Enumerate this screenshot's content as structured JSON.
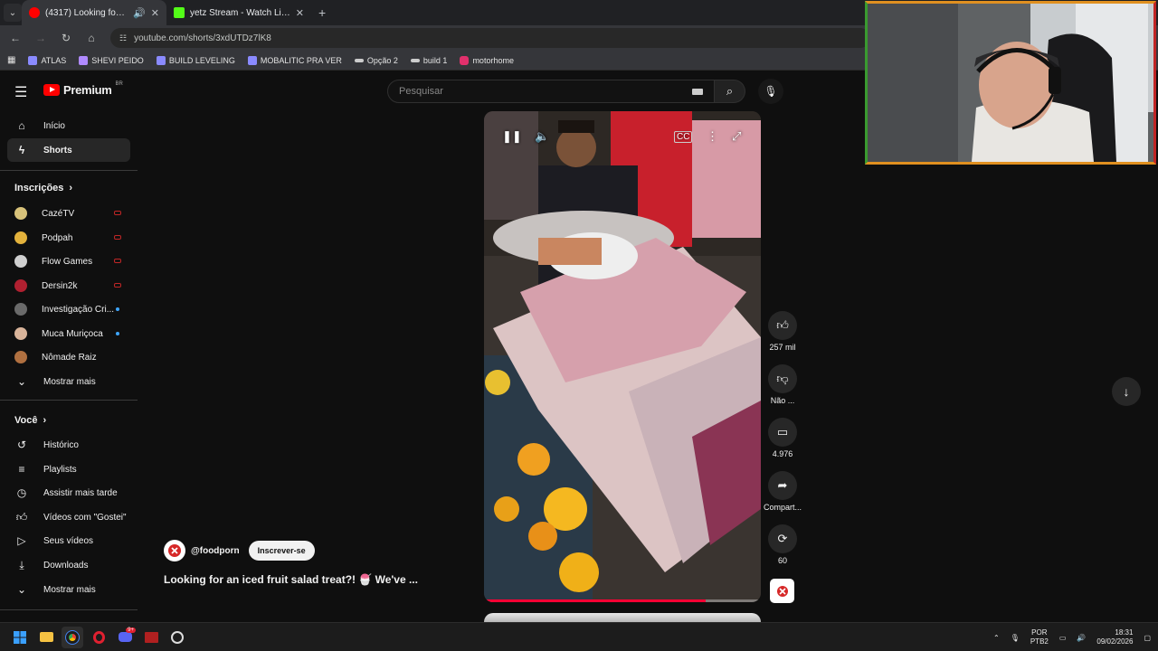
{
  "browser": {
    "tabs": [
      {
        "title": "(4317) Looking for an iced f",
        "active": true,
        "favicon_color": "#ff0000"
      },
      {
        "title": "yetz Stream - Watch Live on Kic",
        "active": false,
        "favicon_color": "#53fc18"
      }
    ],
    "url": "youtube.com/shorts/3xdUTDz7lK8",
    "bookmarks": [
      {
        "label": "ATLAS",
        "icon": "shield-icon",
        "color": "#8a8aff"
      },
      {
        "label": "SHEVI PEIDO",
        "icon": "bookmark-icon",
        "color": "#b08aff"
      },
      {
        "label": "BUILD LEVELING",
        "icon": "shield-icon",
        "color": "#8a8aff"
      },
      {
        "label": "MOBALITIC PRA VER",
        "icon": "shield-icon",
        "color": "#8a8aff"
      },
      {
        "label": "Opção 2",
        "icon": "link-icon",
        "color": "#cccccc"
      },
      {
        "label": "build 1",
        "icon": "link-icon",
        "color": "#cccccc"
      },
      {
        "label": "motorhome",
        "icon": "instagram-icon",
        "color": "#e1306c"
      }
    ]
  },
  "youtube": {
    "brand": "Premium",
    "country": "BR",
    "search_placeholder": "Pesquisar",
    "sidebar": {
      "main": [
        {
          "label": "Início",
          "icon": "home-icon",
          "active": false
        },
        {
          "label": "Shorts",
          "icon": "shorts-icon",
          "active": true
        }
      ],
      "subscriptions_header": "Inscrições",
      "subscriptions": [
        {
          "label": "CazéTV",
          "avatar_color": "#d8c27a",
          "status": "live"
        },
        {
          "label": "Podpah",
          "avatar_color": "#e3b23c",
          "status": "live"
        },
        {
          "label": "Flow Games",
          "avatar_color": "#cfcfcf",
          "status": "live"
        },
        {
          "label": "Dersin2k",
          "avatar_color": "#b02030",
          "status": "live"
        },
        {
          "label": "Investigação Cri...",
          "avatar_color": "#6a6a6a",
          "status": "new"
        },
        {
          "label": "Muca Muriçoca",
          "avatar_color": "#d9b49a",
          "status": "new"
        },
        {
          "label": "Nômade Raiz",
          "avatar_color": "#b07040",
          "status": "none"
        }
      ],
      "subscriptions_more": "Mostrar mais",
      "you_header": "Você",
      "you": [
        {
          "label": "Histórico",
          "icon": "history-icon"
        },
        {
          "label": "Playlists",
          "icon": "playlist-icon"
        },
        {
          "label": "Assistir mais tarde",
          "icon": "clock-icon"
        },
        {
          "label": "Vídeos com \"Gostei\"",
          "icon": "thumbs-up-icon"
        },
        {
          "label": "Seus vídeos",
          "icon": "video-icon"
        },
        {
          "label": "Downloads",
          "icon": "download-icon"
        }
      ],
      "you_more": "Mostrar mais"
    },
    "short": {
      "channel": "@foodporn",
      "subscribe_label": "Inscrever-se",
      "title": "Looking for an iced fruit salad treat?! 🍧 We've ...",
      "progress": 0.8,
      "actions": {
        "likes": "257 mil",
        "dislike_label": "Não ...",
        "comments": "4.976",
        "share_label": "Compart...",
        "remix_count": "60"
      }
    }
  },
  "taskbar": {
    "language": "POR",
    "layout": "PTB2",
    "time": "18:31",
    "date": "09/02/2026",
    "discord_badge": "9+"
  }
}
